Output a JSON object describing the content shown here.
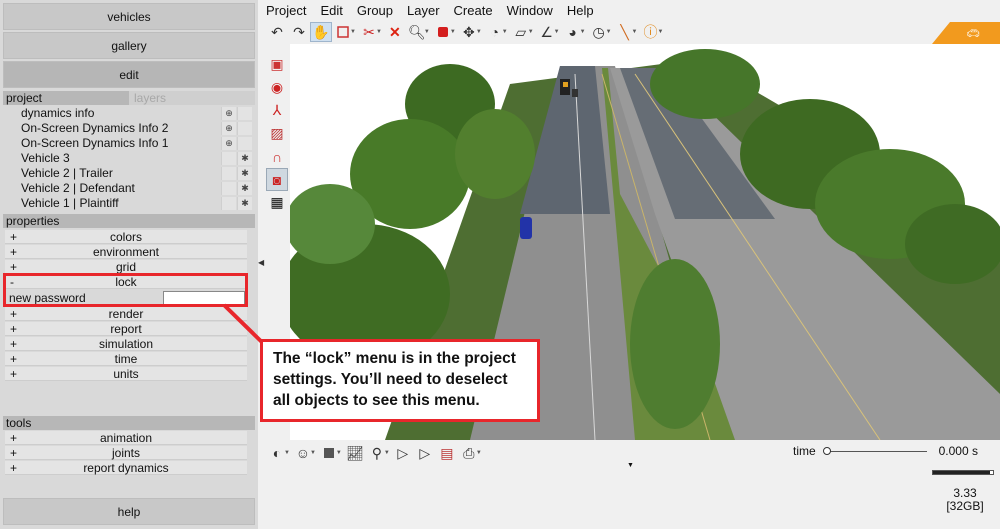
{
  "nav": {
    "vehicles": "vehicles",
    "gallery": "gallery",
    "edit": "edit",
    "help": "help"
  },
  "tabs": {
    "project": "project",
    "layers": "layers"
  },
  "project_items": [
    {
      "name": "dynamics info",
      "c1": "⊕",
      "c2": ""
    },
    {
      "name": "On-Screen Dynamics Info 2",
      "c1": "⊕",
      "c2": ""
    },
    {
      "name": "On-Screen Dynamics Info 1",
      "c1": "⊕",
      "c2": ""
    },
    {
      "name": "Vehicle 3",
      "c1": "",
      "c2": "✱"
    },
    {
      "name": "Vehicle 2 | Trailer",
      "c1": "",
      "c2": "✱"
    },
    {
      "name": "Vehicle 2 | Defendant",
      "c1": "",
      "c2": "✱"
    },
    {
      "name": "Vehicle 1 | Plaintiff",
      "c1": "",
      "c2": "✱"
    }
  ],
  "properties": {
    "heading": "properties",
    "items": [
      {
        "sign": "+",
        "label": "colors"
      },
      {
        "sign": "+",
        "label": "environment"
      },
      {
        "sign": "+",
        "label": "grid"
      },
      {
        "sign": "-",
        "label": "lock"
      },
      {
        "sign": "+",
        "label": "render"
      },
      {
        "sign": "+",
        "label": "report"
      },
      {
        "sign": "+",
        "label": "simulation"
      },
      {
        "sign": "+",
        "label": "time"
      },
      {
        "sign": "+",
        "label": "units"
      }
    ],
    "password_label": "new password",
    "password_value": ""
  },
  "tools": {
    "heading": "tools",
    "items": [
      {
        "sign": "+",
        "label": "animation"
      },
      {
        "sign": "+",
        "label": "joints"
      },
      {
        "sign": "+",
        "label": "report dynamics"
      }
    ]
  },
  "menu": [
    "Project",
    "Edit",
    "Group",
    "Layer",
    "Create",
    "Window",
    "Help"
  ],
  "callout_text": "The “lock” menu is in the project settings. You’ll need to deselect all objects to see this menu.",
  "time": {
    "label": "time",
    "value": "0.000 s",
    "slider_position": 0
  },
  "progress_fraction": 0.95,
  "version": {
    "number": "3.33",
    "memory": "[32GB]"
  },
  "colors": {
    "accent_red": "#e8262b",
    "logo_orange": "#f29a1e"
  }
}
